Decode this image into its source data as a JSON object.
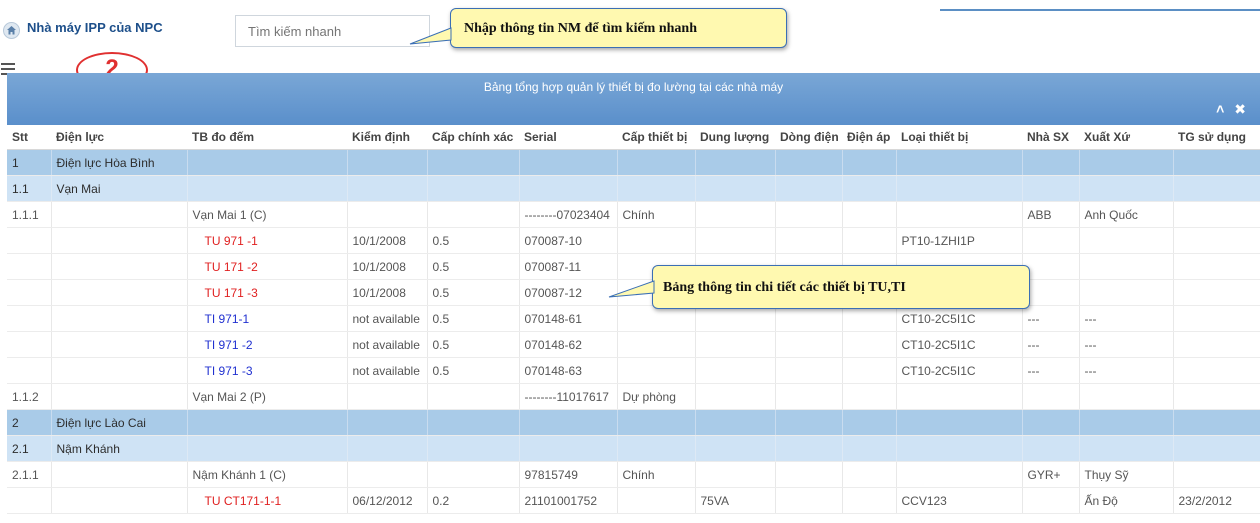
{
  "header": {
    "title": "Nhà máy IPP của NPC",
    "search_placeholder": "Tìm kiếm nhanh"
  },
  "annotations": {
    "search_hint": "Nhập thông tin NM để tìm kiếm nhanh",
    "marker": "2",
    "table_hint": "Bảng thông tin chi tiết các thiết bị TU,TI"
  },
  "panel": {
    "title": "Bảng tổng hợp quản lý thiết bị đo lường tại các nhà máy",
    "collapse_icon": "chevron-up-icon",
    "close_icon": "close-icon"
  },
  "colors": {
    "header_gradient_top": "#7aa7d6",
    "header_gradient_bottom": "#5a8fcb",
    "level1_row": "#a9cbe8",
    "level2_row": "#cfe3f5",
    "tu_text": "#e02020",
    "ti_text": "#2030d0",
    "callout_bg": "#fff9b0"
  },
  "columns": [
    "Stt",
    "Điện lực",
    "TB đo đếm",
    "Kiểm định",
    "Cấp chính xác",
    "Serial",
    "Cấp thiết bị",
    "Dung lượng",
    "Dòng điện",
    "Điện áp",
    "Loại thiết bị",
    "Nhà SX",
    "Xuất Xứ",
    "TG sử dụng"
  ],
  "rows": [
    {
      "level": 1,
      "cells": [
        "1",
        "Điện lực Hòa Bình",
        "",
        "",
        "",
        "",
        "",
        "",
        "",
        "",
        "",
        "",
        "",
        ""
      ]
    },
    {
      "level": 2,
      "cells": [
        "1.1",
        "Vạn Mai",
        "",
        "",
        "",
        "",
        "",
        "",
        "",
        "",
        "",
        "",
        "",
        ""
      ]
    },
    {
      "level": 3,
      "cells": [
        "1.1.1",
        "",
        "Vạn Mai 1 (C)",
        "",
        "",
        "--------07023404",
        "Chính",
        "",
        "",
        "",
        "",
        "ABB",
        "Anh Quốc",
        ""
      ]
    },
    {
      "level": 4,
      "type": "TU",
      "cells": [
        "",
        "",
        "TU 971 -1",
        "10/1/2008",
        "0.5",
        "070087-10",
        "",
        "",
        "",
        "",
        "PT10-1ZHI1P",
        "",
        "",
        ""
      ]
    },
    {
      "level": 4,
      "type": "TU",
      "cells": [
        "",
        "",
        "TU 171 -2",
        "10/1/2008",
        "0.5",
        "070087-11",
        "",
        "",
        "",
        "",
        "",
        "",
        "",
        ""
      ]
    },
    {
      "level": 4,
      "type": "TU",
      "cells": [
        "",
        "",
        "TU 171 -3",
        "10/1/2008",
        "0.5",
        "070087-12",
        "",
        "",
        "",
        "",
        "",
        "",
        "",
        ""
      ]
    },
    {
      "level": 4,
      "type": "TI",
      "cells": [
        "",
        "",
        "TI 971-1",
        "not available",
        "0.5",
        "070148-61",
        "",
        "",
        "",
        "",
        "CT10-2C5I1C",
        "---",
        "---",
        ""
      ]
    },
    {
      "level": 4,
      "type": "TI",
      "cells": [
        "",
        "",
        "TI 971 -2",
        "not available",
        "0.5",
        "070148-62",
        "",
        "",
        "",
        "",
        "CT10-2C5I1C",
        "---",
        "---",
        ""
      ]
    },
    {
      "level": 4,
      "type": "TI",
      "cells": [
        "",
        "",
        "TI 971 -3",
        "not available",
        "0.5",
        "070148-63",
        "",
        "",
        "",
        "",
        "CT10-2C5I1C",
        "---",
        "---",
        ""
      ]
    },
    {
      "level": 3,
      "cells": [
        "1.1.2",
        "",
        "Vạn Mai 2 (P)",
        "",
        "",
        "--------11017617",
        "Dự phòng",
        "",
        "",
        "",
        "",
        "",
        "",
        ""
      ]
    },
    {
      "level": 1,
      "cells": [
        "2",
        "Điện lực Lào Cai",
        "",
        "",
        "",
        "",
        "",
        "",
        "",
        "",
        "",
        "",
        "",
        ""
      ]
    },
    {
      "level": 2,
      "cells": [
        "2.1",
        "Nậm Khánh",
        "",
        "",
        "",
        "",
        "",
        "",
        "",
        "",
        "",
        "",
        "",
        ""
      ]
    },
    {
      "level": 3,
      "cells": [
        "2.1.1",
        "",
        "Nậm Khánh 1 (C)",
        "",
        "",
        "97815749",
        "Chính",
        "",
        "",
        "",
        "",
        "GYR+",
        "Thụy Sỹ",
        ""
      ]
    },
    {
      "level": 4,
      "type": "TU",
      "cells": [
        "",
        "",
        "TU CT171-1-1",
        "06/12/2012",
        "0.2",
        "21101001752",
        "",
        "75VA",
        "",
        "",
        "CCV123",
        "",
        "Ấn Độ",
        "23/2/2012"
      ]
    }
  ]
}
